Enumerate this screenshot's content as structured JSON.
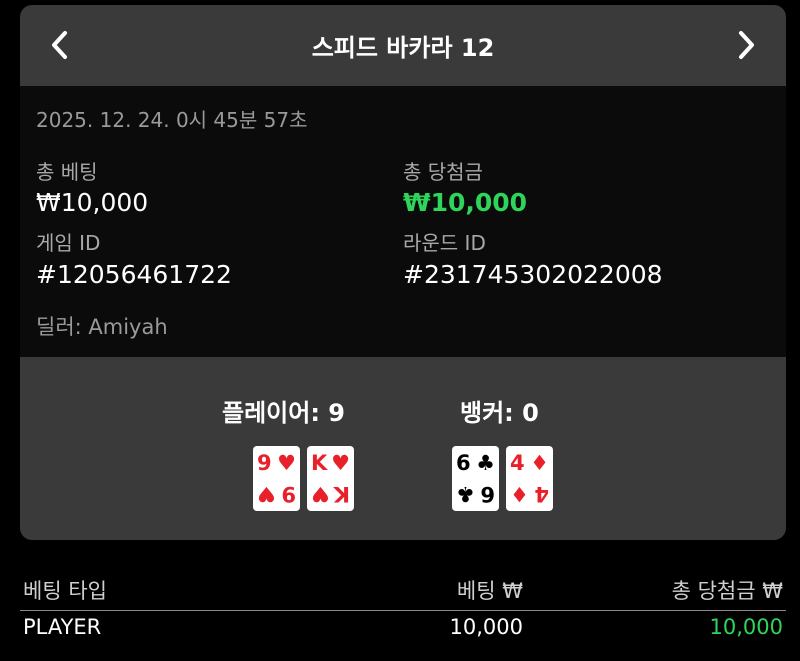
{
  "header": {
    "title": "스피드 바카라 12",
    "prev_icon": "chevron-left-icon",
    "next_icon": "chevron-right-icon"
  },
  "round_info": {
    "timestamp": "2025. 12. 24. 0시 45분 57초",
    "total_bet_label": "총 베팅",
    "total_bet_value": "₩10,000",
    "total_win_label": "총 당첨금",
    "total_win_value": "₩10,000",
    "game_id_label": "게임 ID",
    "game_id_value": "#12056461722",
    "round_id_label": "라운드 ID",
    "round_id_value": "#231745302022008",
    "dealer": "딜러: Amiyah"
  },
  "hands": {
    "player_label": "플레이어: 9",
    "banker_label": "뱅커: 0",
    "player_cards": [
      {
        "rank": "9",
        "suit": "♥",
        "color": "#e8202a"
      },
      {
        "rank": "K",
        "suit": "♥",
        "color": "#e8202a"
      }
    ],
    "banker_cards": [
      {
        "rank": "6",
        "suit": "♣",
        "color": "#000000"
      },
      {
        "rank": "4",
        "suit": "♦",
        "color": "#e8202a"
      }
    ]
  },
  "bets_table": {
    "columns": [
      "베팅 타입",
      "베팅 ₩",
      "총 당첨금 ₩"
    ],
    "rows": [
      {
        "type": "PLAYER",
        "bet": "10,000",
        "win": "10,000"
      }
    ]
  },
  "colors": {
    "win_green": "#2fd45b",
    "panel_bg": "#3a3a3a",
    "info_bg": "#0b0b0b"
  }
}
